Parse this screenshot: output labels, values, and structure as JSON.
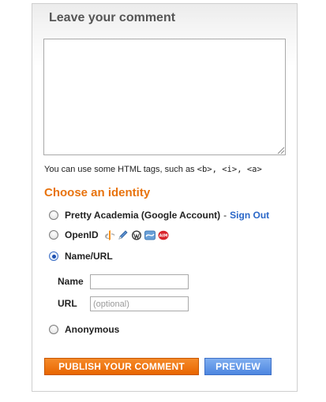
{
  "header": {
    "title": "Leave your comment"
  },
  "comment": {
    "value": "",
    "placeholder": ""
  },
  "html_hint": {
    "prefix": "You can use some HTML tags, such as",
    "tags": "<b>, <i>, <a>"
  },
  "identity": {
    "title": "Choose an identity",
    "options": [
      {
        "label": "Pretty Academia (Google Account)",
        "separator": "-",
        "link": "Sign Out",
        "checked": false
      },
      {
        "label": "OpenID",
        "checked": false,
        "icons": [
          "openid-icon",
          "livejournal-icon",
          "wordpress-icon",
          "typepad-icon",
          "aim-icon"
        ]
      },
      {
        "label": "Name/URL",
        "checked": true
      },
      {
        "label": "Anonymous",
        "checked": false
      }
    ]
  },
  "name_url": {
    "name_label": "Name",
    "name_value": "",
    "url_label": "URL",
    "url_placeholder": "(optional)"
  },
  "buttons": {
    "publish": "Publish Your Comment",
    "preview": "Preview"
  },
  "colors": {
    "accent_orange": "#e8730e",
    "link_blue": "#2a67c8",
    "publish_bg": "#f07a14",
    "preview_bg": "#5b92e5"
  }
}
